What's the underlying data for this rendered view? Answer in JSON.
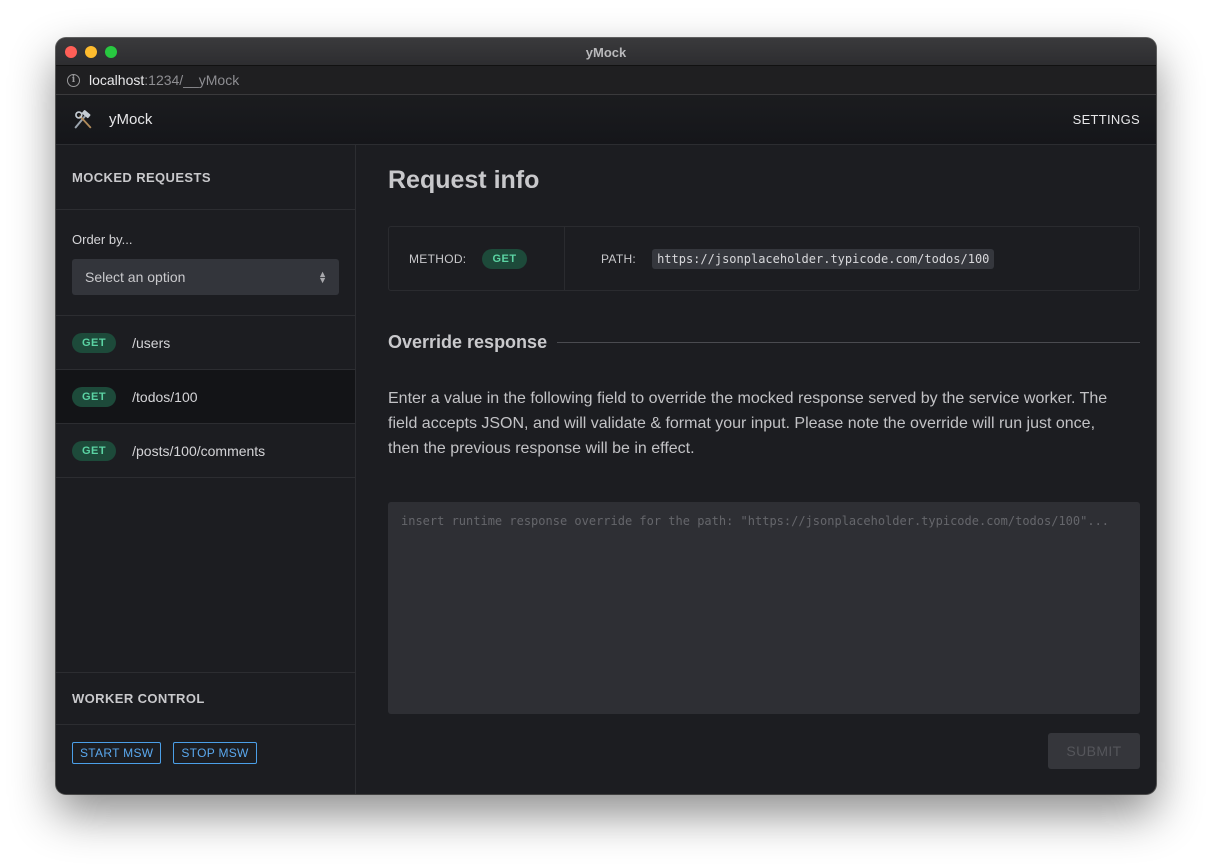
{
  "window": {
    "title": "yMock"
  },
  "url": {
    "host": "localhost",
    "rest": ":1234/__yMock"
  },
  "app": {
    "name": "yMock",
    "settings_label": "SETTINGS"
  },
  "sidebar": {
    "heading": "MOCKED REQUESTS",
    "order_label": "Order by...",
    "order_select_value": "Select an option",
    "requests": [
      {
        "method": "GET",
        "path": "/users",
        "active": false
      },
      {
        "method": "GET",
        "path": "/todos/100",
        "active": true
      },
      {
        "method": "GET",
        "path": "/posts/100/comments",
        "active": false
      }
    ],
    "worker_heading": "WORKER CONTROL",
    "start_label": "START MSW",
    "stop_label": "STOP MSW"
  },
  "main": {
    "title": "Request info",
    "method_label": "METHOD:",
    "method_value": "GET",
    "path_label": "PATH:",
    "path_value": "https://jsonplaceholder.typicode.com/todos/100",
    "override_title": "Override response",
    "description": "Enter a value in the following field to override the mocked response served by the service worker. The field accepts JSON, and will validate & format your input. Please note the override will run just once, then the previous response will be in effect.",
    "override_placeholder": "insert runtime response override for the path: \"https://jsonplaceholder.typicode.com/todos/100\"...",
    "submit_label": "SUBMIT"
  }
}
